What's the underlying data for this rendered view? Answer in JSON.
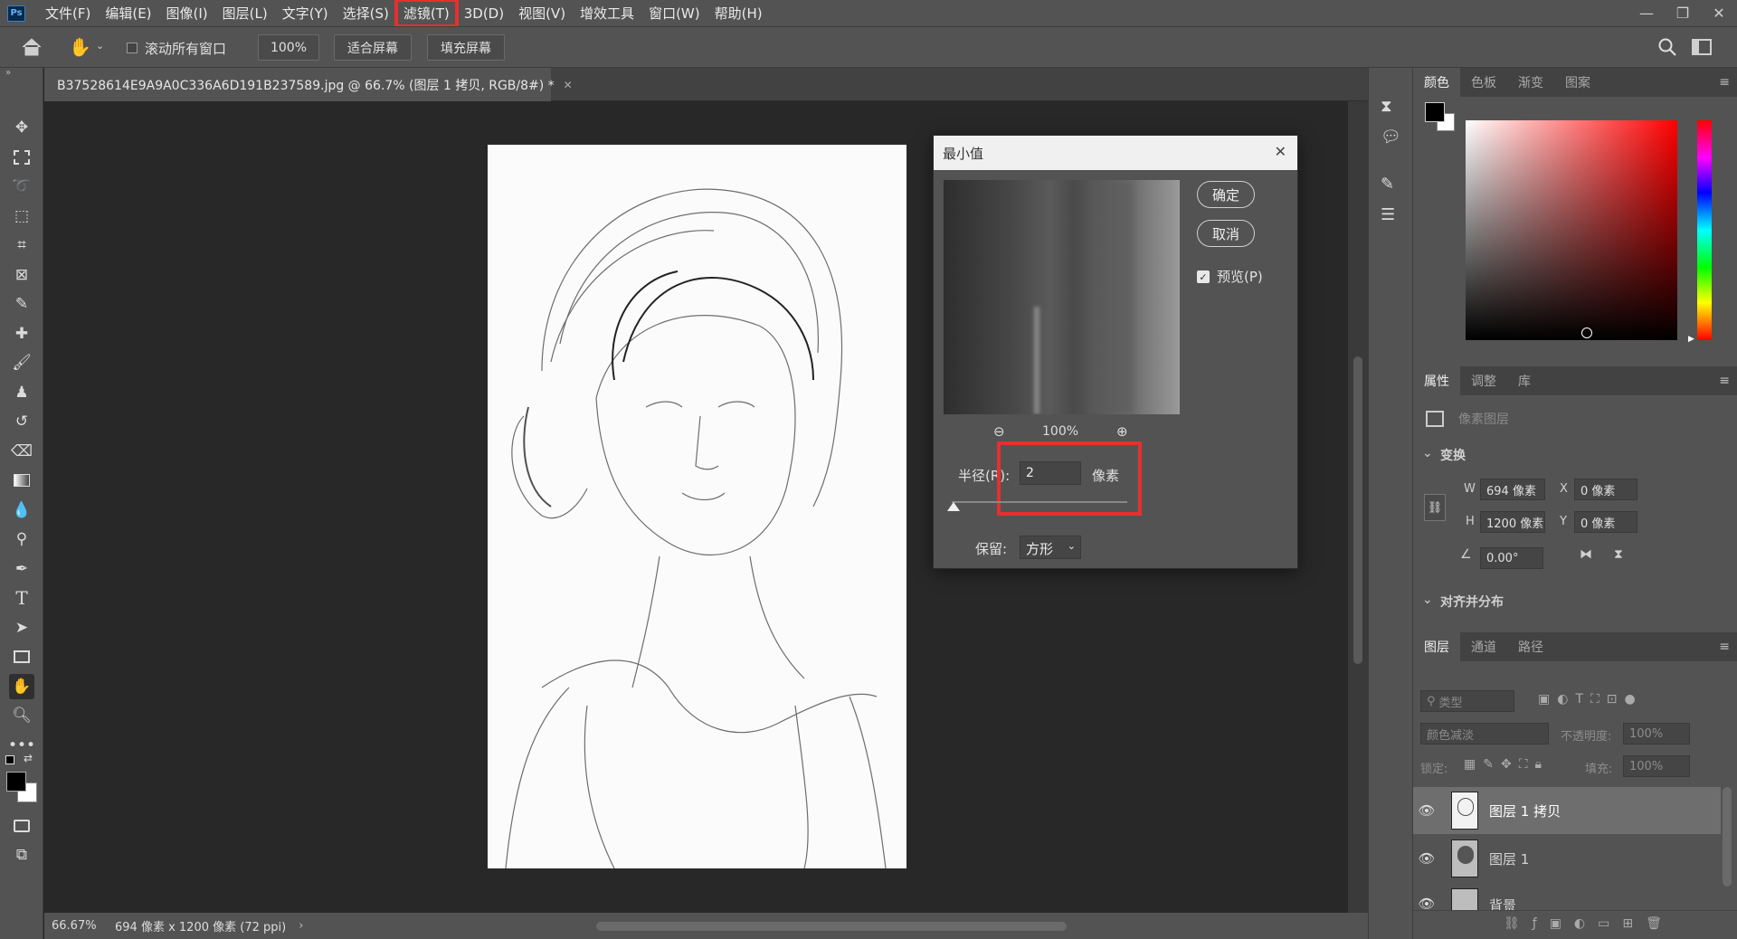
{
  "menu": [
    "文件(F)",
    "编辑(E)",
    "图像(I)",
    "图层(L)",
    "文字(Y)",
    "选择(S)",
    "滤镜(T)",
    "3D(D)",
    "视图(V)",
    "增效工具",
    "窗口(W)",
    "帮助(H)"
  ],
  "app_logo": "Ps",
  "options": {
    "scroll_all": "滚动所有窗口",
    "zoom": "100%",
    "fit_screen": "适合屏幕",
    "fill_screen": "填充屏幕"
  },
  "document": {
    "tab_title": "B37528614E9A9A0C336A6D191B237589.jpg @ 66.7% (图层 1 拷贝, RGB/8#) *",
    "zoom_status": "66.67%",
    "size_status": "694 像素 x 1200 像素 (72 ppi)"
  },
  "dialog": {
    "title": "最小值",
    "ok": "确定",
    "cancel": "取消",
    "preview_label": "预览(P)",
    "preview_checked": true,
    "preview_zoom": "100%",
    "radius_label": "半径(R):",
    "radius_value": "2",
    "radius_unit": "像素",
    "keep_label": "保留:",
    "keep_value": "方形",
    "slider_fraction": 0.01
  },
  "color_panel": {
    "tabs": [
      "颜色",
      "色板",
      "渐变",
      "图案"
    ],
    "foreground": "#000000",
    "background": "#ffffff",
    "hue": "#ff0000"
  },
  "properties_panel": {
    "tabs": [
      "属性",
      "调整",
      "库"
    ],
    "layer_type": "像素图层",
    "transform_title": "变换",
    "w_label": "W",
    "w_value": "694 像素",
    "h_label": "H",
    "h_value": "1200 像素",
    "x_label": "X",
    "x_value": "0 像素",
    "y_label": "Y",
    "y_value": "0 像素",
    "angle": "0.00°",
    "align_title": "对齐并分布"
  },
  "layers_panel": {
    "tabs": [
      "图层",
      "通道",
      "路径"
    ],
    "filter_placeholder": "类型",
    "blend_mode": "颜色减淡",
    "opacity_label": "不透明度:",
    "opacity": "100%",
    "lock_label": "锁定:",
    "fill_label": "填充:",
    "fill": "100%",
    "layers": [
      {
        "name": "图层 1 拷贝",
        "selected": true
      },
      {
        "name": "图层 1",
        "selected": false
      },
      {
        "name": "背景",
        "selected": false
      }
    ]
  }
}
